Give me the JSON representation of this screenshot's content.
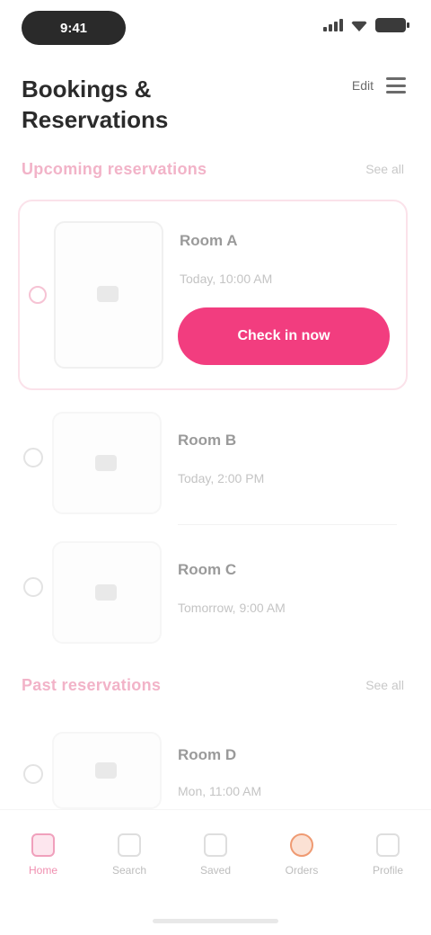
{
  "status": {
    "time": "9:41"
  },
  "header": {
    "title": "Bookings & Reservations",
    "action_label": "Edit"
  },
  "sections": [
    {
      "title": "Upcoming reservations",
      "more": "See all"
    },
    {
      "title": "Past reservations",
      "more": "See all"
    }
  ],
  "featured": {
    "title": "Room A",
    "subtitle": "Today, 10:00 AM",
    "button_label": "Check in now"
  },
  "upcoming": [
    {
      "title": "Room B",
      "subtitle": "Today, 2:00 PM"
    },
    {
      "title": "Room C",
      "subtitle": "Tomorrow, 9:00 AM"
    }
  ],
  "past": [
    {
      "title": "Room D",
      "subtitle": "Mon, 11:00 AM"
    }
  ],
  "nav": [
    {
      "label": "Home",
      "icon": "home-icon"
    },
    {
      "label": "Search",
      "icon": "search-icon"
    },
    {
      "label": "Saved",
      "icon": "bookmark-icon"
    },
    {
      "label": "Orders",
      "icon": "orders-icon"
    },
    {
      "label": "Profile",
      "icon": "profile-icon"
    }
  ],
  "colors": {
    "accent": "#f23d7f",
    "section_title": "#f2b3c8"
  }
}
